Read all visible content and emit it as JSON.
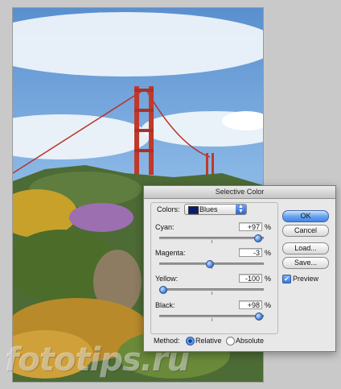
{
  "watermark": "fototips.ru",
  "dialog": {
    "title": "Selective Color",
    "colors_label": "Colors:",
    "colors_value": "Blues",
    "sliders": [
      {
        "label": "Cyan:",
        "value": "+97",
        "unit": "%",
        "level": 0.985
      },
      {
        "label": "Magenta:",
        "value": "-3",
        "unit": "%",
        "level": 0.485
      },
      {
        "label": "Yellow:",
        "value": "-100",
        "unit": "%",
        "level": 0.0
      },
      {
        "label": "Black:",
        "value": "+98",
        "unit": "%",
        "level": 0.99
      }
    ],
    "buttons": {
      "ok": "OK",
      "cancel": "Cancel",
      "load": "Load...",
      "save": "Save..."
    },
    "preview_label": "Preview",
    "preview_checked": true,
    "method_label": "Method:",
    "method_options": [
      "Relative",
      "Absolute"
    ],
    "method_selected": "Relative",
    "accent_color": "#3f86e6"
  }
}
